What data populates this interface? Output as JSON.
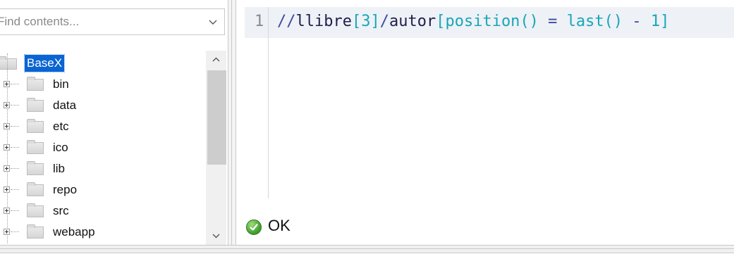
{
  "file_browser": {
    "search": {
      "placeholder": "Find contents..."
    },
    "root": {
      "label": "BaseX"
    },
    "items": [
      {
        "label": "bin"
      },
      {
        "label": "data"
      },
      {
        "label": "etc"
      },
      {
        "label": "ico"
      },
      {
        "label": "lib"
      },
      {
        "label": "repo"
      },
      {
        "label": "src"
      },
      {
        "label": "webapp"
      }
    ],
    "scrollbar": {
      "up_icon": "chevron-up-icon",
      "down_icon": "chevron-down-icon"
    }
  },
  "editor": {
    "line_number": "1",
    "tokens": [
      {
        "text": "//",
        "kind": "op"
      },
      {
        "text": "llibre",
        "kind": "name"
      },
      {
        "text": "[",
        "kind": "br"
      },
      {
        "text": "3",
        "kind": "num"
      },
      {
        "text": "]",
        "kind": "br"
      },
      {
        "text": "/",
        "kind": "op"
      },
      {
        "text": "autor",
        "kind": "name"
      },
      {
        "text": "[",
        "kind": "br"
      },
      {
        "text": "position",
        "kind": "fn"
      },
      {
        "text": "()",
        "kind": "br"
      },
      {
        "text": " = ",
        "kind": "op"
      },
      {
        "text": "last",
        "kind": "fn"
      },
      {
        "text": "()",
        "kind": "br"
      },
      {
        "text": " - ",
        "kind": "op"
      },
      {
        "text": "1",
        "kind": "num"
      },
      {
        "text": "]",
        "kind": "br"
      }
    ]
  },
  "status": {
    "text": "OK",
    "icon": "check-circle-icon"
  },
  "colors": {
    "selection": "#0a64d2",
    "current_line": "#eef1f6",
    "ok_green": "#3d9a2a"
  }
}
